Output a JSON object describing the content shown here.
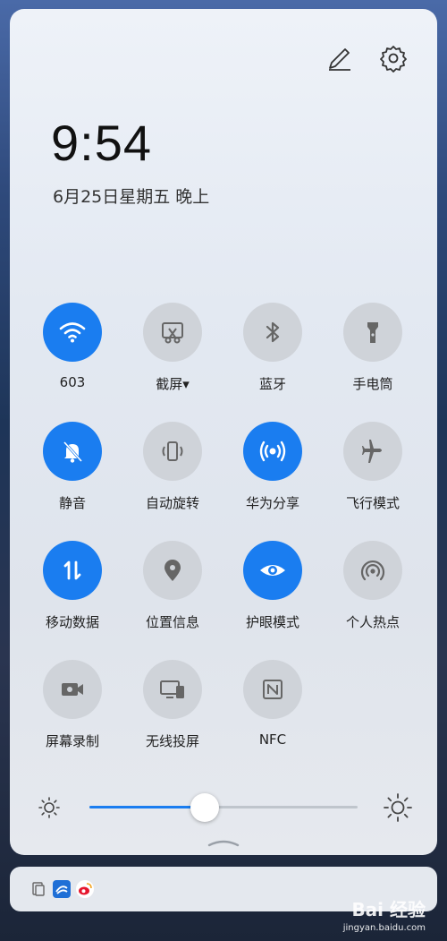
{
  "clock": {
    "time": "9:54",
    "date": "6月25日星期五 晚上"
  },
  "tiles": [
    {
      "label": "603",
      "icon": "wifi-icon",
      "on": true
    },
    {
      "label": "截屏",
      "icon": "screenshot-icon",
      "on": false,
      "dropdown": "▾"
    },
    {
      "label": "蓝牙",
      "icon": "bluetooth-icon",
      "on": false
    },
    {
      "label": "手电筒",
      "icon": "flashlight-icon",
      "on": false
    },
    {
      "label": "静音",
      "icon": "mute-bell-icon",
      "on": true
    },
    {
      "label": "自动旋转",
      "icon": "auto-rotate-icon",
      "on": false
    },
    {
      "label": "华为分享",
      "icon": "huawei-share-icon",
      "on": true
    },
    {
      "label": "飞行模式",
      "icon": "airplane-icon",
      "on": false
    },
    {
      "label": "移动数据",
      "icon": "mobile-data-icon",
      "on": true
    },
    {
      "label": "位置信息",
      "icon": "location-icon",
      "on": false
    },
    {
      "label": "护眼模式",
      "icon": "eye-comfort-icon",
      "on": true
    },
    {
      "label": "个人热点",
      "icon": "hotspot-icon",
      "on": false
    },
    {
      "label": "屏幕录制",
      "icon": "screen-record-icon",
      "on": false
    },
    {
      "label": "无线投屏",
      "icon": "wireless-projection-icon",
      "on": false
    },
    {
      "label": "NFC",
      "icon": "nfc-icon",
      "on": false
    }
  ],
  "brightness": {
    "level": 0.43
  },
  "colors": {
    "accent": "#1a7df0",
    "off": "#cfd3d9"
  },
  "notifications": [
    "clipboard-icon",
    "weibo-browser-icon",
    "weibo-icon"
  ],
  "watermark": {
    "brand": "Bai 经验",
    "url": "jingyan.baidu.com"
  }
}
